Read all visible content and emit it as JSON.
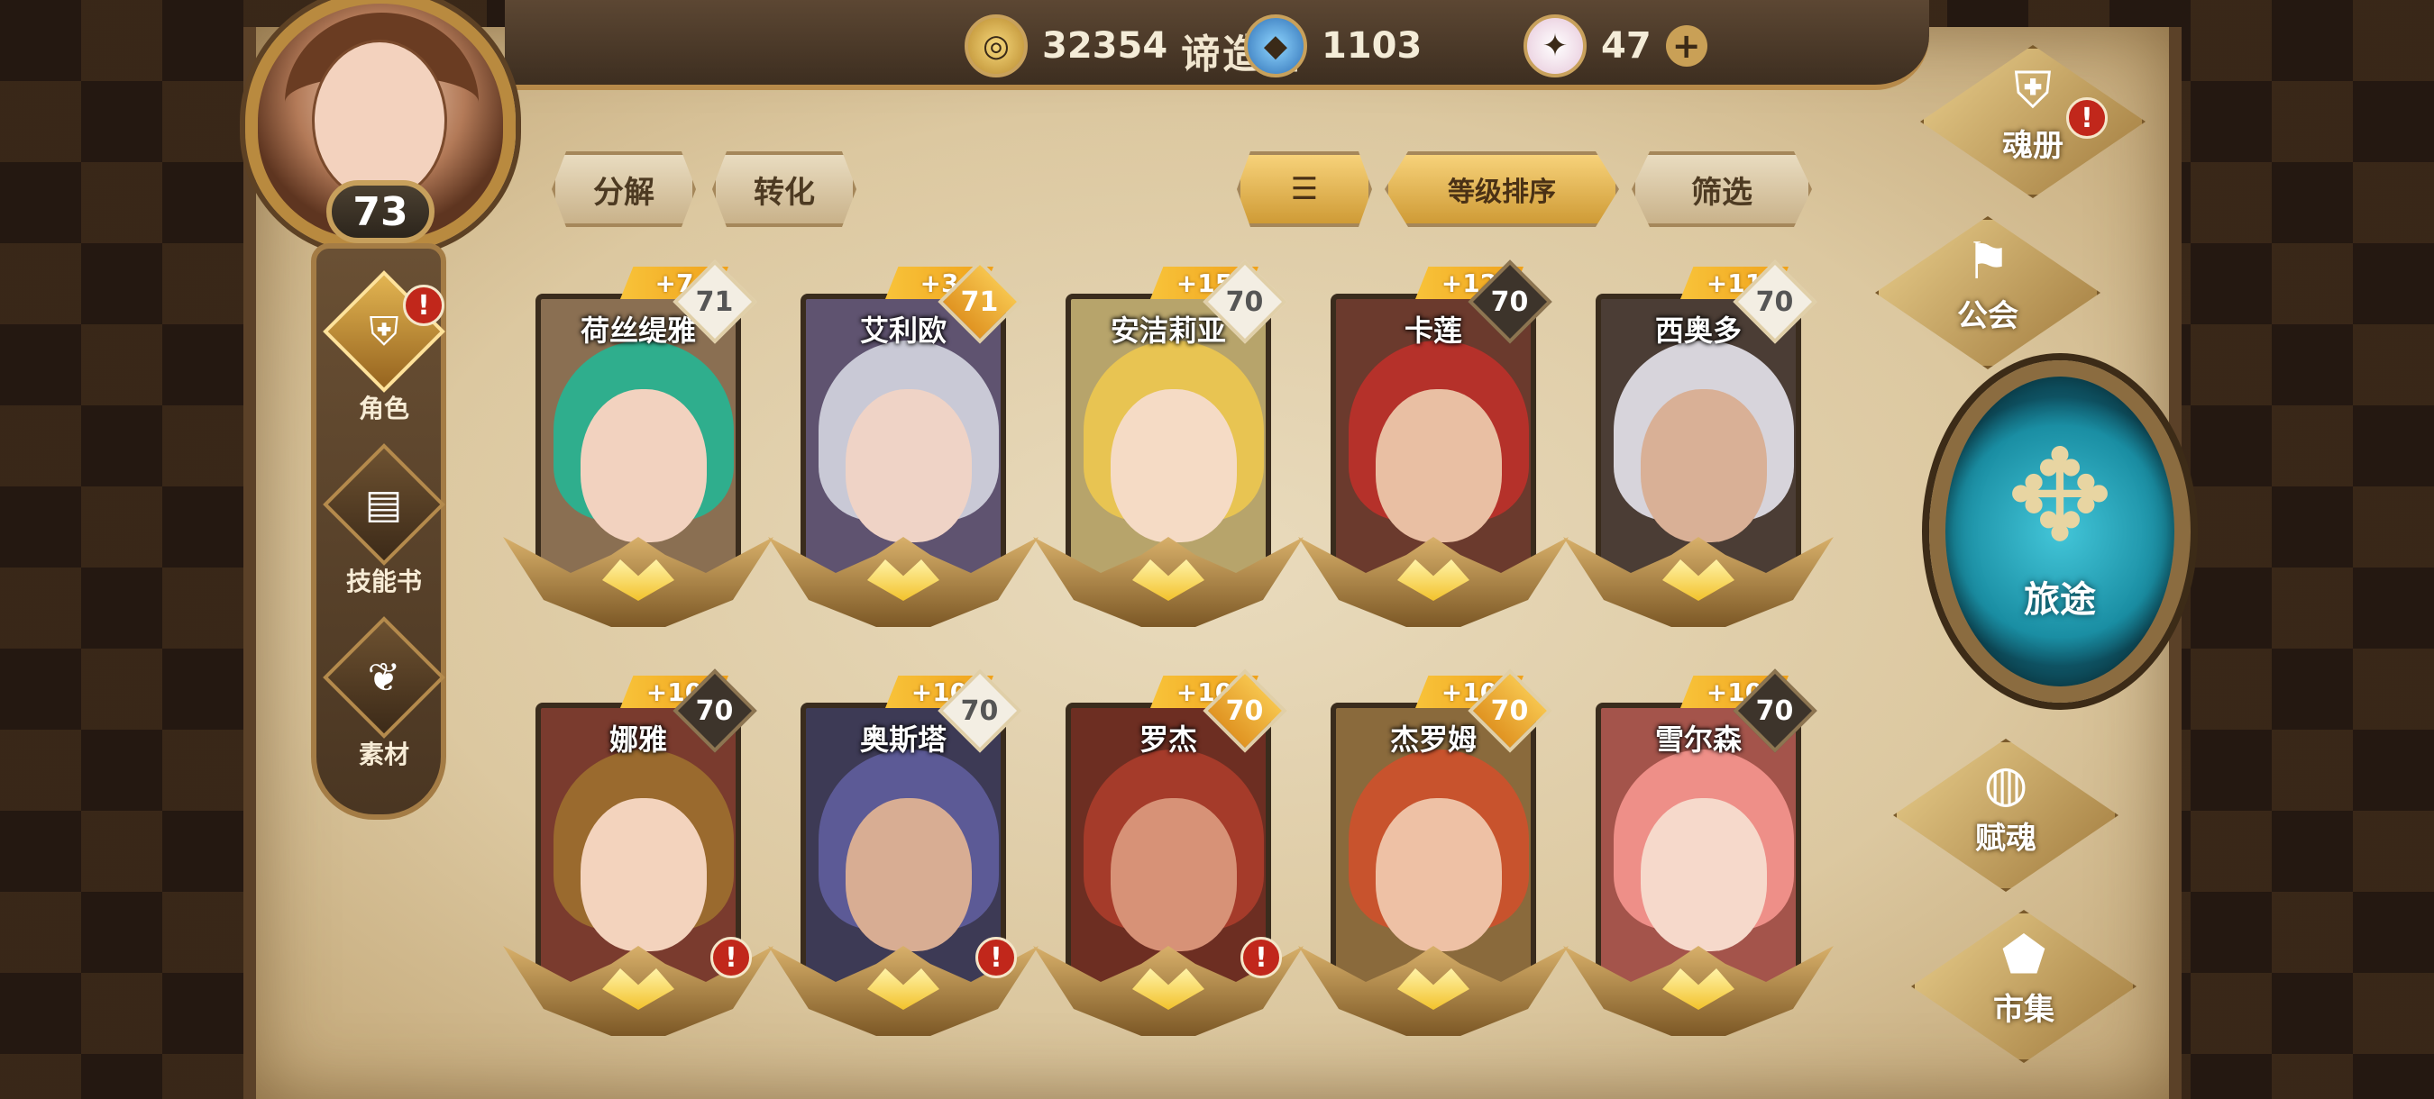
{
  "player": {
    "name": "谛造者",
    "level": "73"
  },
  "currencies": [
    {
      "icon": "gold-coin-icon",
      "value": "32354"
    },
    {
      "icon": "blue-crystal-icon",
      "value": "1103"
    },
    {
      "icon": "gem-icon",
      "value": "47",
      "add_label": "+"
    }
  ],
  "sidebar": {
    "items": [
      {
        "label": "角色",
        "icon": "character-helmet-icon",
        "active": true,
        "alert": "!"
      },
      {
        "label": "技能书",
        "icon": "skill-book-icon",
        "active": false
      },
      {
        "label": "素材",
        "icon": "material-icon",
        "active": false
      }
    ]
  },
  "actions": {
    "decompose": "分解",
    "convert": "转化",
    "sort_icon": "sort-icon",
    "sort_by_level": "等级排序",
    "filter": "筛选"
  },
  "heroes": [
    {
      "name": "荷丝缇雅",
      "plus": "+7",
      "level": "71",
      "level_style": "white",
      "hair": "#2fae8d",
      "alert": false
    },
    {
      "name": "艾利欧",
      "plus": "+3",
      "level": "71",
      "level_style": "gold",
      "hair": "#c9c9d6",
      "alert": false
    },
    {
      "name": "安洁莉亚",
      "plus": "+15",
      "level": "70",
      "level_style": "white",
      "hair": "#e8c452",
      "alert": false
    },
    {
      "name": "卡莲",
      "plus": "+12",
      "level": "70",
      "level_style": "dark",
      "hair": "#b5312a",
      "alert": false
    },
    {
      "name": "西奥多",
      "plus": "+11",
      "level": "70",
      "level_style": "white",
      "hair": "#d7d4db",
      "alert": false
    },
    {
      "name": "娜雅",
      "plus": "+10",
      "level": "70",
      "level_style": "dark",
      "hair": "#9a6a2e",
      "alert": true
    },
    {
      "name": "奥斯塔",
      "plus": "+10",
      "level": "70",
      "level_style": "white",
      "hair": "#5c5a96",
      "alert": true
    },
    {
      "name": "罗杰",
      "plus": "+10",
      "level": "70",
      "level_style": "gold",
      "hair": "#a53b2a",
      "alert": true
    },
    {
      "name": "杰罗姆",
      "plus": "+10",
      "level": "70",
      "level_style": "gold",
      "hair": "#c8532d",
      "alert": false
    },
    {
      "name": "雪尔森",
      "plus": "+10",
      "level": "70",
      "level_style": "dark",
      "hair": "#ee8f88",
      "alert": false
    }
  ],
  "right_menu": {
    "soul_book": {
      "label": "魂册",
      "icon": "soul-book-icon",
      "alert": "!"
    },
    "guild": {
      "label": "公会",
      "icon": "guild-flag-icon"
    },
    "journey": {
      "label": "旅途",
      "icon": "journey-emblem-icon"
    },
    "endow_soul": {
      "label": "赋魂",
      "icon": "endow-soul-icon"
    },
    "market": {
      "label": "市集",
      "icon": "market-icon"
    }
  },
  "colors": {
    "accent_gold": "#e9b44a",
    "alert_red": "#c1271b",
    "journey_teal": "#2fb6cc"
  }
}
